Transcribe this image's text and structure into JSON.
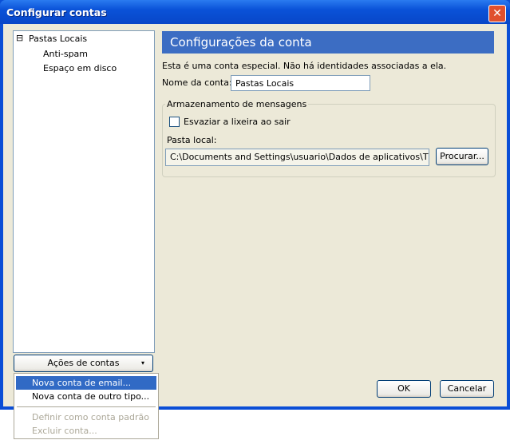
{
  "window": {
    "title": "Configurar contas",
    "close": "✕"
  },
  "tree": {
    "expander": "⊟",
    "items": [
      {
        "label": "Pastas Locais"
      },
      {
        "label": "Anti-spam"
      },
      {
        "label": "Espaço em disco"
      }
    ]
  },
  "account_actions": {
    "label": "Ações de contas",
    "arrow": "▾"
  },
  "menu": {
    "items": [
      {
        "label": "Nova conta de email...",
        "state": "highlighted"
      },
      {
        "label": "Nova conta de outro tipo..."
      },
      {
        "label": "Definir como conta padrão",
        "state": "disabled"
      },
      {
        "label": "Excluir conta...",
        "state": "disabled"
      }
    ]
  },
  "panel": {
    "header": "Configurações da conta",
    "info": "Esta é uma conta especial. Não há identidades associadas a ela.",
    "name_label": "Nome da conta:",
    "name_value": "Pastas Locais",
    "storage": {
      "legend": "Armazenamento de mensagens",
      "empty_trash_label": "Esvaziar a lixeira ao sair",
      "empty_trash_checked": false,
      "local_folder_label": "Pasta local:",
      "local_folder_value": "C:\\Documents and Settings\\usuario\\Dados de aplicativos\\Thunderbird",
      "browse": "Procurar..."
    }
  },
  "footer": {
    "ok": "OK",
    "cancel": "Cancelar"
  }
}
